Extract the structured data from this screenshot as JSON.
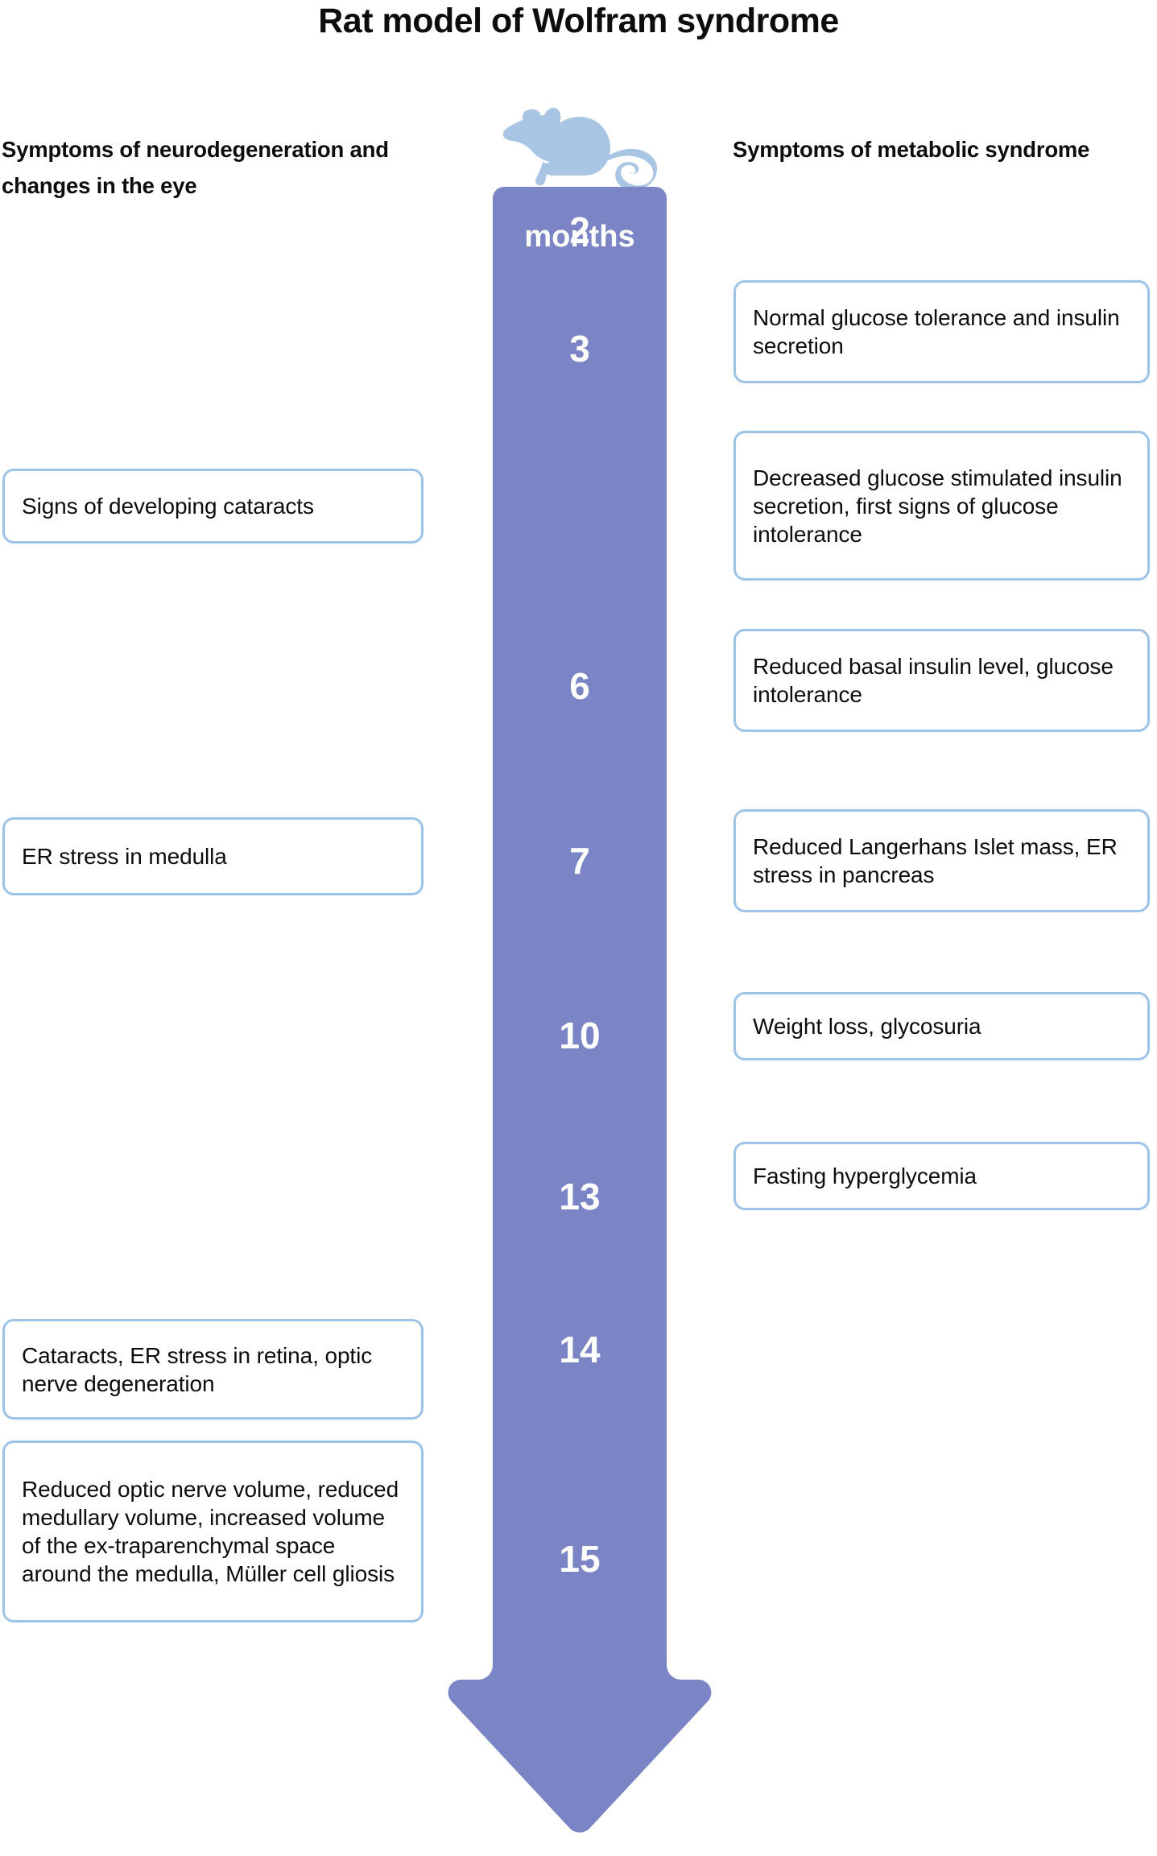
{
  "title": "Rat model of Wolfram syndrome",
  "colors": {
    "arrow": "#7b84c4",
    "box_border": "#9dc3e6",
    "rat_icon": "#a8c6e4",
    "text": "#0d0d0d",
    "month_text": "#ffffff"
  },
  "headers": {
    "left": "Symptoms of neurodegeneration and changes in the eye",
    "right": "Symptoms of metabolic syndrome"
  },
  "icons": {
    "rat": "rat-silhouette-icon",
    "arrow": "down-arrow-timeline"
  },
  "timeline": {
    "caption": "months",
    "months": [
      "2",
      "3",
      "6",
      "7",
      "10",
      "13",
      "14",
      "15"
    ]
  },
  "left_symptoms": [
    {
      "month": "3",
      "text": "Signs of developing cataracts"
    },
    {
      "month": "7",
      "text": "ER stress in medulla"
    },
    {
      "month": "14",
      "text": "Cataracts, ER stress in retina, optic nerve degeneration"
    },
    {
      "month": "15",
      "text": "Reduced optic nerve volume, reduced medullary volume, increased  volume of the ex-traparenchymal space around the medulla, Müller cell gliosis"
    }
  ],
  "right_symptoms": [
    {
      "month": "2",
      "text": "Normal glucose tolerance and insulin secretion"
    },
    {
      "month": "3",
      "text": "Decreased glucose stimulated insulin secretion, first signs of glucose intolerance"
    },
    {
      "month": "6",
      "text": "Reduced basal insulin level, glucose intolerance"
    },
    {
      "month": "7",
      "text": "Reduced Langerhans Islet mass, ER stress in pancreas"
    },
    {
      "month": "10",
      "text": "Weight loss, glycosuria"
    },
    {
      "month": "13",
      "text": "Fasting hyperglycemia"
    }
  ]
}
